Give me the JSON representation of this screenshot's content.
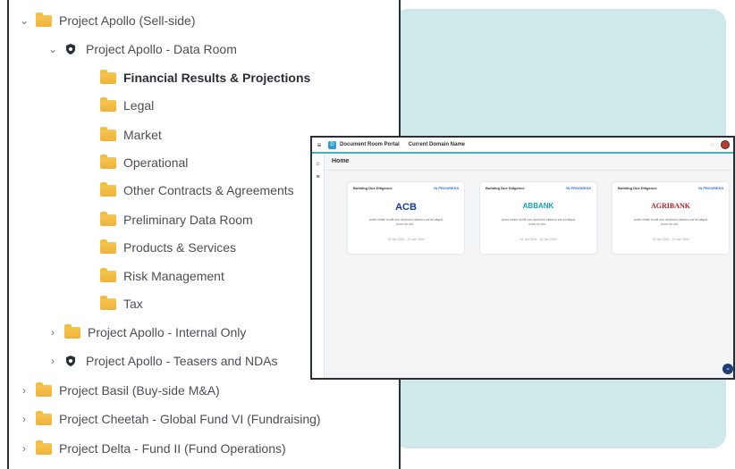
{
  "tree": {
    "items": [
      {
        "label": "Project Apollo (Sell-side)",
        "chevron": "v",
        "icon": "folder-icon",
        "bold": false
      },
      {
        "label": "Project Apollo - Data Room",
        "chevron": "v",
        "icon": "shield-icon",
        "bold": false
      },
      {
        "label": "Financial Results & Projections",
        "chevron": "",
        "icon": "folder-icon",
        "bold": true
      },
      {
        "label": "Legal",
        "chevron": "",
        "icon": "folder-icon",
        "bold": false
      },
      {
        "label": "Market",
        "chevron": "",
        "icon": "folder-icon",
        "bold": false
      },
      {
        "label": "Operational",
        "chevron": "",
        "icon": "folder-icon",
        "bold": false
      },
      {
        "label": "Other Contracts & Agreements",
        "chevron": "",
        "icon": "folder-icon",
        "bold": false
      },
      {
        "label": "Preliminary Data Room",
        "chevron": "",
        "icon": "folder-icon",
        "bold": false
      },
      {
        "label": "Products & Services",
        "chevron": "",
        "icon": "folder-icon",
        "bold": false
      },
      {
        "label": "Risk Management",
        "chevron": "",
        "icon": "folder-icon",
        "bold": false
      },
      {
        "label": "Tax",
        "chevron": "",
        "icon": "folder-icon",
        "bold": false
      },
      {
        "label": "Project Apollo - Internal Only",
        "chevron": ">",
        "icon": "folder-icon",
        "bold": false
      },
      {
        "label": "Project Apollo - Teasers and NDAs",
        "chevron": ">",
        "icon": "shield-icon",
        "bold": false
      },
      {
        "label": "Project Basil (Buy-side M&A)",
        "chevron": ">",
        "icon": "folder-icon",
        "bold": false
      },
      {
        "label": "Project Cheetah - Global Fund VI (Fundraising)",
        "chevron": ">",
        "icon": "folder-icon",
        "bold": false
      },
      {
        "label": "Project Delta - Fund II (Fund Operations)",
        "chevron": ">",
        "icon": "folder-icon",
        "bold": false
      }
    ]
  },
  "portal": {
    "app_title": "Document Room Portal",
    "domain": "Current Domain Name",
    "page_title": "Home",
    "cards": [
      {
        "title": "Building Due Diligence",
        "status": "IN PROGRESS",
        "logo": "ACB",
        "logo_color": "#1a3a8a",
        "desc": "Amet minim mollit non deserunt ullamco est sit aliqua dolor do am...",
        "date": "15 Jan 2024 - 31 Jan 2024"
      },
      {
        "title": "Building Due Diligence",
        "status": "IN PROGRESS",
        "logo": "ABBANK",
        "logo_color": "#16a3b0",
        "desc": "Amet minim mollit non deserunt ullamco est sit aliqua dolor do am...",
        "date": "15 Jan 2024 - 31 Jan 2024"
      },
      {
        "title": "Building Due Diligence",
        "status": "IN PROGRESS",
        "logo": "AGRIBANK",
        "logo_color": "#b0202a",
        "desc": "Amet minim mollit non deserunt ullamco est sit aliqua dolor do am...",
        "date": "15 Jan 2024 - 31 Jan 2024"
      }
    ]
  },
  "colors": {
    "accent": "#43b3bd",
    "background_panel": "#cfe8ea",
    "status": "#2d6fd8"
  }
}
